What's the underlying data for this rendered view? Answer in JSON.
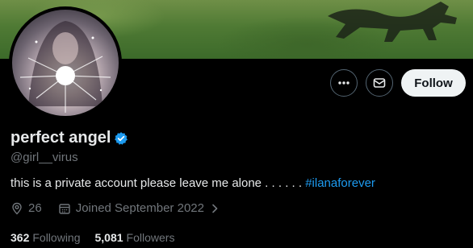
{
  "profile": {
    "display_name": "perfect angel",
    "handle": "@girl__virus",
    "bio_text": "this is a private account please leave me alone . . . . . .",
    "bio_hashtag": "#ilanaforever",
    "location": "26",
    "joined": "Joined September 2022"
  },
  "actions": {
    "follow_label": "Follow",
    "more_icon": "more-icon",
    "message_icon": "envelope-icon"
  },
  "stats": {
    "following_count": "362",
    "following_label": "Following",
    "followers_count": "5,081",
    "followers_label": "Followers"
  },
  "colors": {
    "accent": "#1d9bf0",
    "muted": "#71767b",
    "background": "#000000"
  }
}
